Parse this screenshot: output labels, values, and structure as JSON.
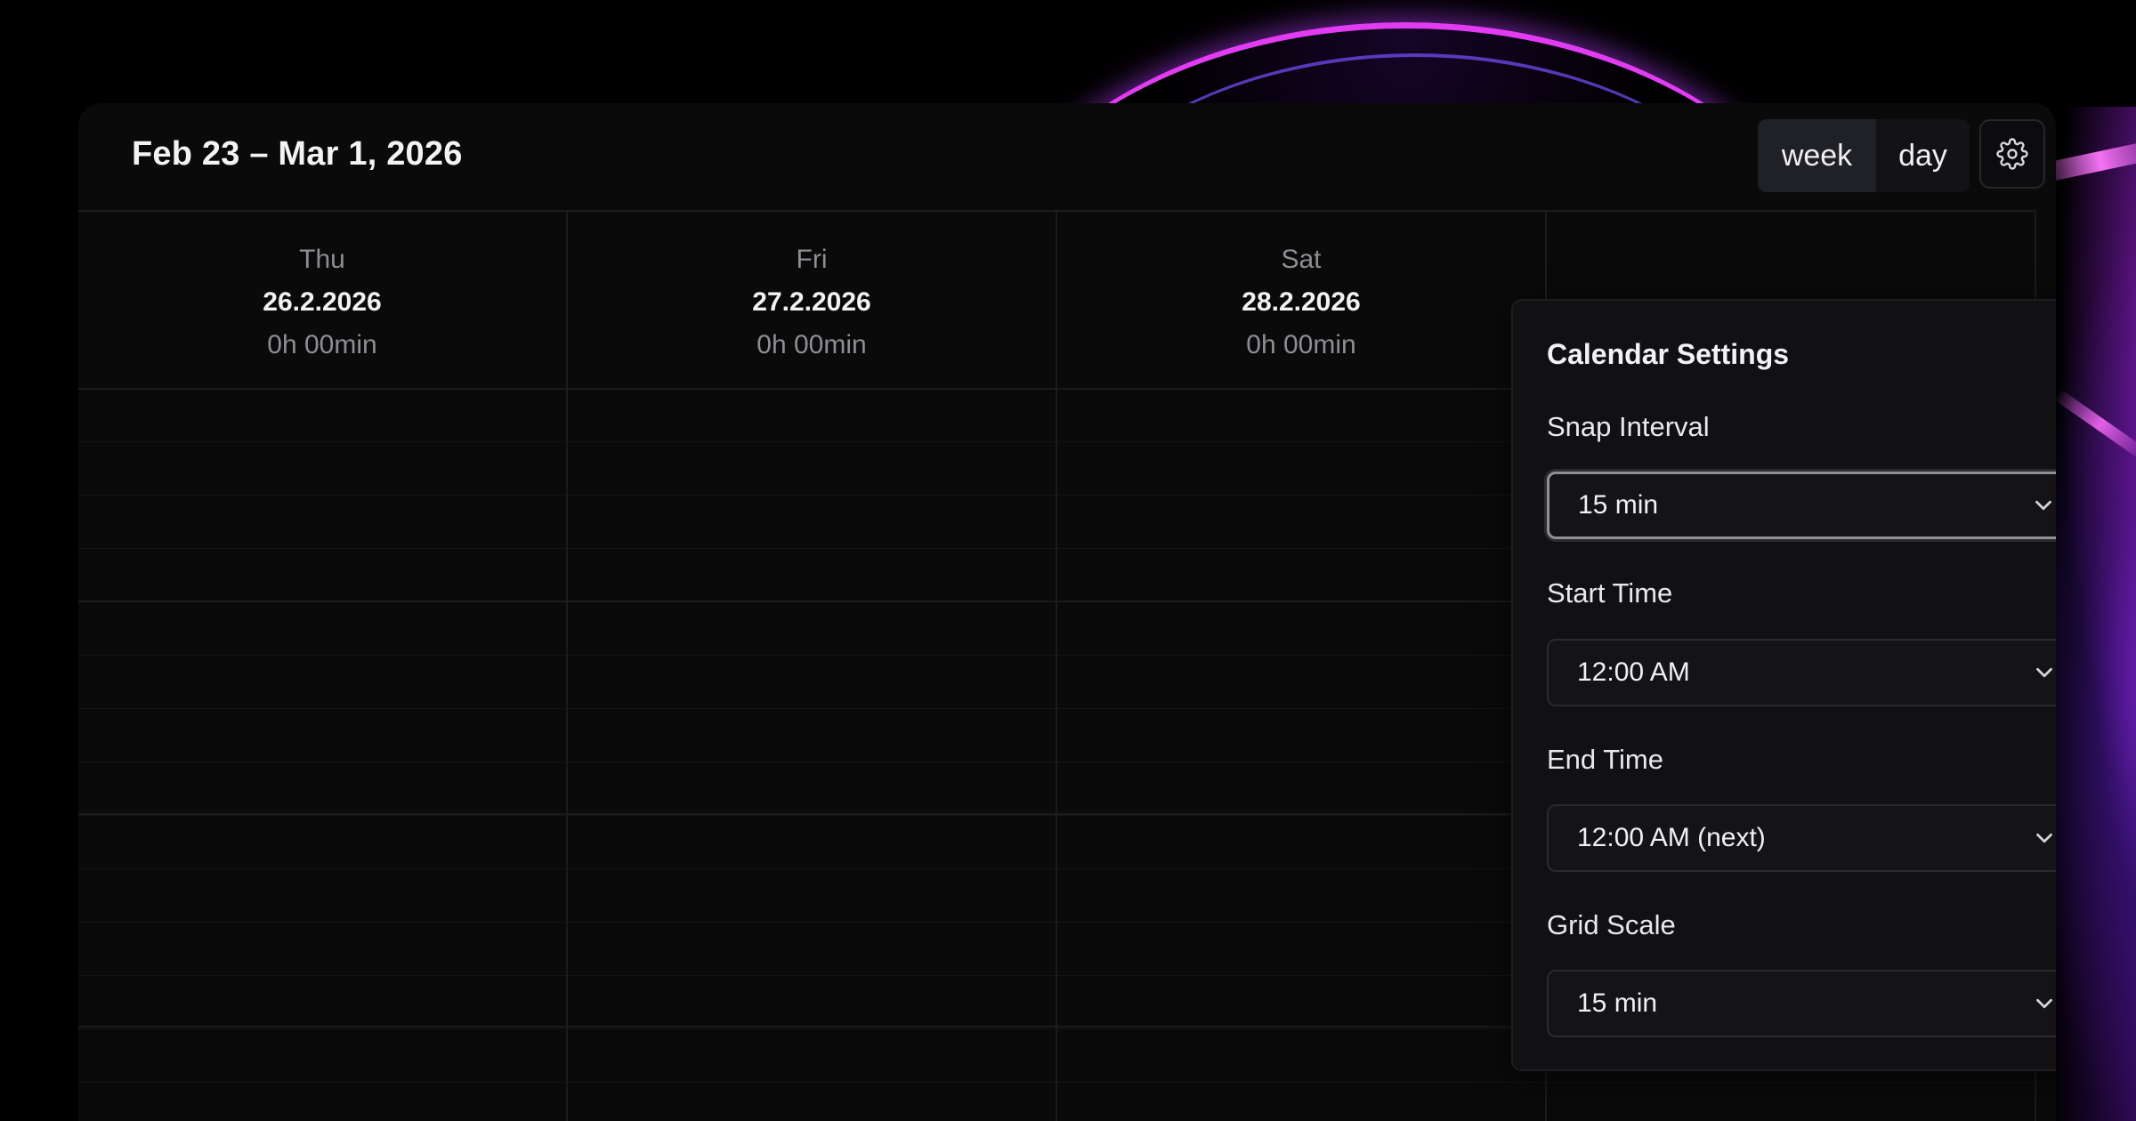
{
  "header": {
    "range_title": "Feb 23 – Mar 1, 2026",
    "view_toggle": {
      "week_label": "week",
      "day_label": "day",
      "active": "week"
    },
    "settings_icon": "gear-icon"
  },
  "columns": [
    {
      "dow": "Thu",
      "date": "26.2.2026",
      "duration": "0h 00min"
    },
    {
      "dow": "Fri",
      "date": "27.2.2026",
      "duration": "0h 00min"
    },
    {
      "dow": "Sat",
      "date": "28.2.2026",
      "duration": "0h 00min"
    }
  ],
  "settings": {
    "title": "Calendar Settings",
    "snap_interval": {
      "label": "Snap Interval",
      "value": "15 min"
    },
    "start_time": {
      "label": "Start Time",
      "value": "12:00 AM"
    },
    "end_time": {
      "label": "End Time",
      "value": "12:00 AM (next)"
    },
    "grid_scale": {
      "label": "Grid Scale",
      "value": "15 min"
    }
  },
  "colors": {
    "background": "#000000",
    "card": "#0a0a0b",
    "popover": "#111113",
    "accent_glow": "#e23cf2"
  }
}
